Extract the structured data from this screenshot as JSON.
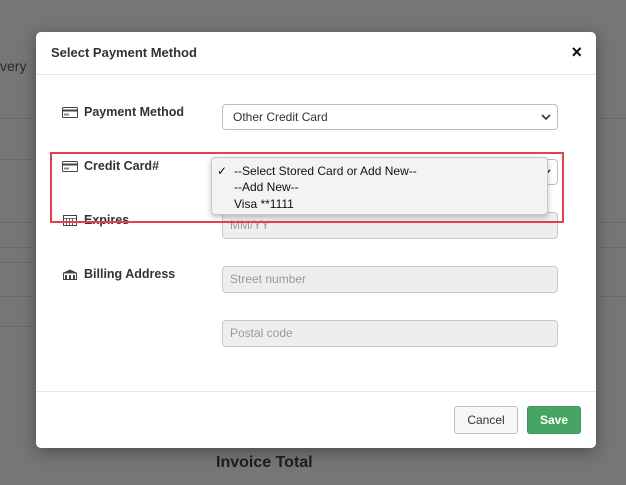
{
  "background": {
    "partial_text": "very",
    "invoice_total_label": "Invoice Total"
  },
  "modal": {
    "title": "Select Payment Method",
    "close_glyph": "×"
  },
  "form": {
    "payment_method": {
      "label": "Payment Method",
      "icon": "credit-card-icon",
      "selected": "Other Credit Card"
    },
    "credit_card": {
      "label": "Credit Card#",
      "icon": "credit-card-icon",
      "options": [
        "--Select Stored Card or Add New--",
        "--Add New--",
        "Visa **1111"
      ],
      "checked_glyph": "✓"
    },
    "expires": {
      "label": "Expires",
      "icon": "calendar-icon",
      "placeholder": "MM/YY"
    },
    "billing_address": {
      "label": "Billing Address",
      "icon": "building-icon",
      "street_placeholder": "Street number",
      "postal_placeholder": "Postal code"
    }
  },
  "footer": {
    "cancel_label": "Cancel",
    "save_label": "Save"
  },
  "colors": {
    "highlight": "#e0434b",
    "save": "#46a564"
  }
}
